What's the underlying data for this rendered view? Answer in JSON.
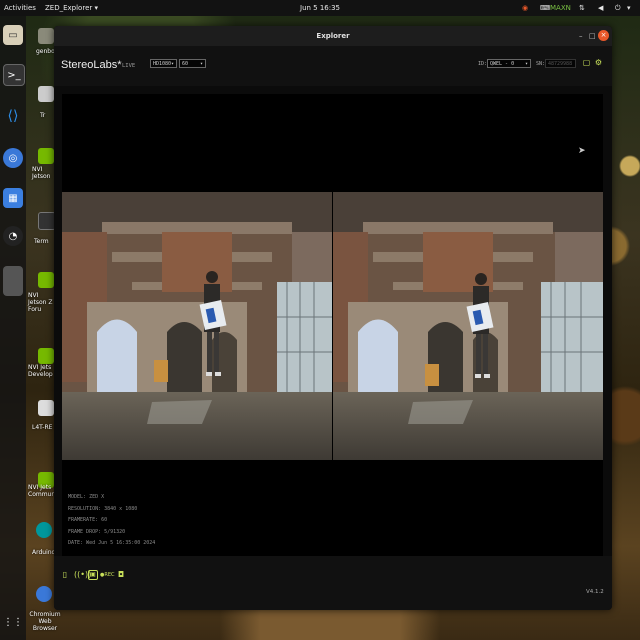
{
  "topbar": {
    "activities": "Activities",
    "app_menu": "ZED_Explorer ▾",
    "clock": "Jun 5  16:35",
    "tray_user": "MAXN"
  },
  "desktop_icons": [
    {
      "label": "genbot",
      "icon": "home-folder-icon"
    },
    {
      "label": "Tr",
      "icon": "file-icon"
    },
    {
      "label": "NVI Jetson",
      "icon": "nvidia-icon"
    },
    {
      "label": "Term",
      "icon": "terminal-icon"
    },
    {
      "label": "NVI Jetson Z Foru",
      "icon": "nvidia-icon"
    },
    {
      "label": "NVI Jets Develop",
      "icon": "nvidia-icon"
    },
    {
      "label": "L4T-RE",
      "icon": "file-icon"
    },
    {
      "label": "NVI Jets Communit",
      "icon": "nvidia-icon"
    },
    {
      "label": "Arduino IC",
      "icon": "arduino-icon"
    },
    {
      "label": "Chromium Web Browser",
      "icon": "chromium-icon"
    }
  ],
  "window": {
    "title": "Explorer",
    "brand": "StereoLabs*",
    "live_label": "LIVE",
    "resolution_select": "HD1080",
    "fps_select": "60",
    "id_label": "ID:",
    "id_value": "QWEL - 0",
    "sn_label": "SN:",
    "sn_value": "48729988",
    "info": {
      "model": "MODEL: ZED X",
      "resolution": "RESOLUTION: 3840 x 1080",
      "framerate": "FRAMERATE: 60",
      "frame_drop": "FRAME DROP: 5/91320",
      "date": "DATE: Wed Jun 5 16:35:00 2024"
    },
    "bottom_buttons": [
      "folder-icon",
      "broadcast-icon",
      "record-icon",
      "rec-label",
      "camera-icon"
    ],
    "rec_label": "●REC",
    "version": "V4.1.2"
  },
  "colors": {
    "accent": "#c8e05a",
    "close": "#e8582a",
    "window_bg": "#0b0b0b",
    "topbar_bg": "#121212"
  }
}
